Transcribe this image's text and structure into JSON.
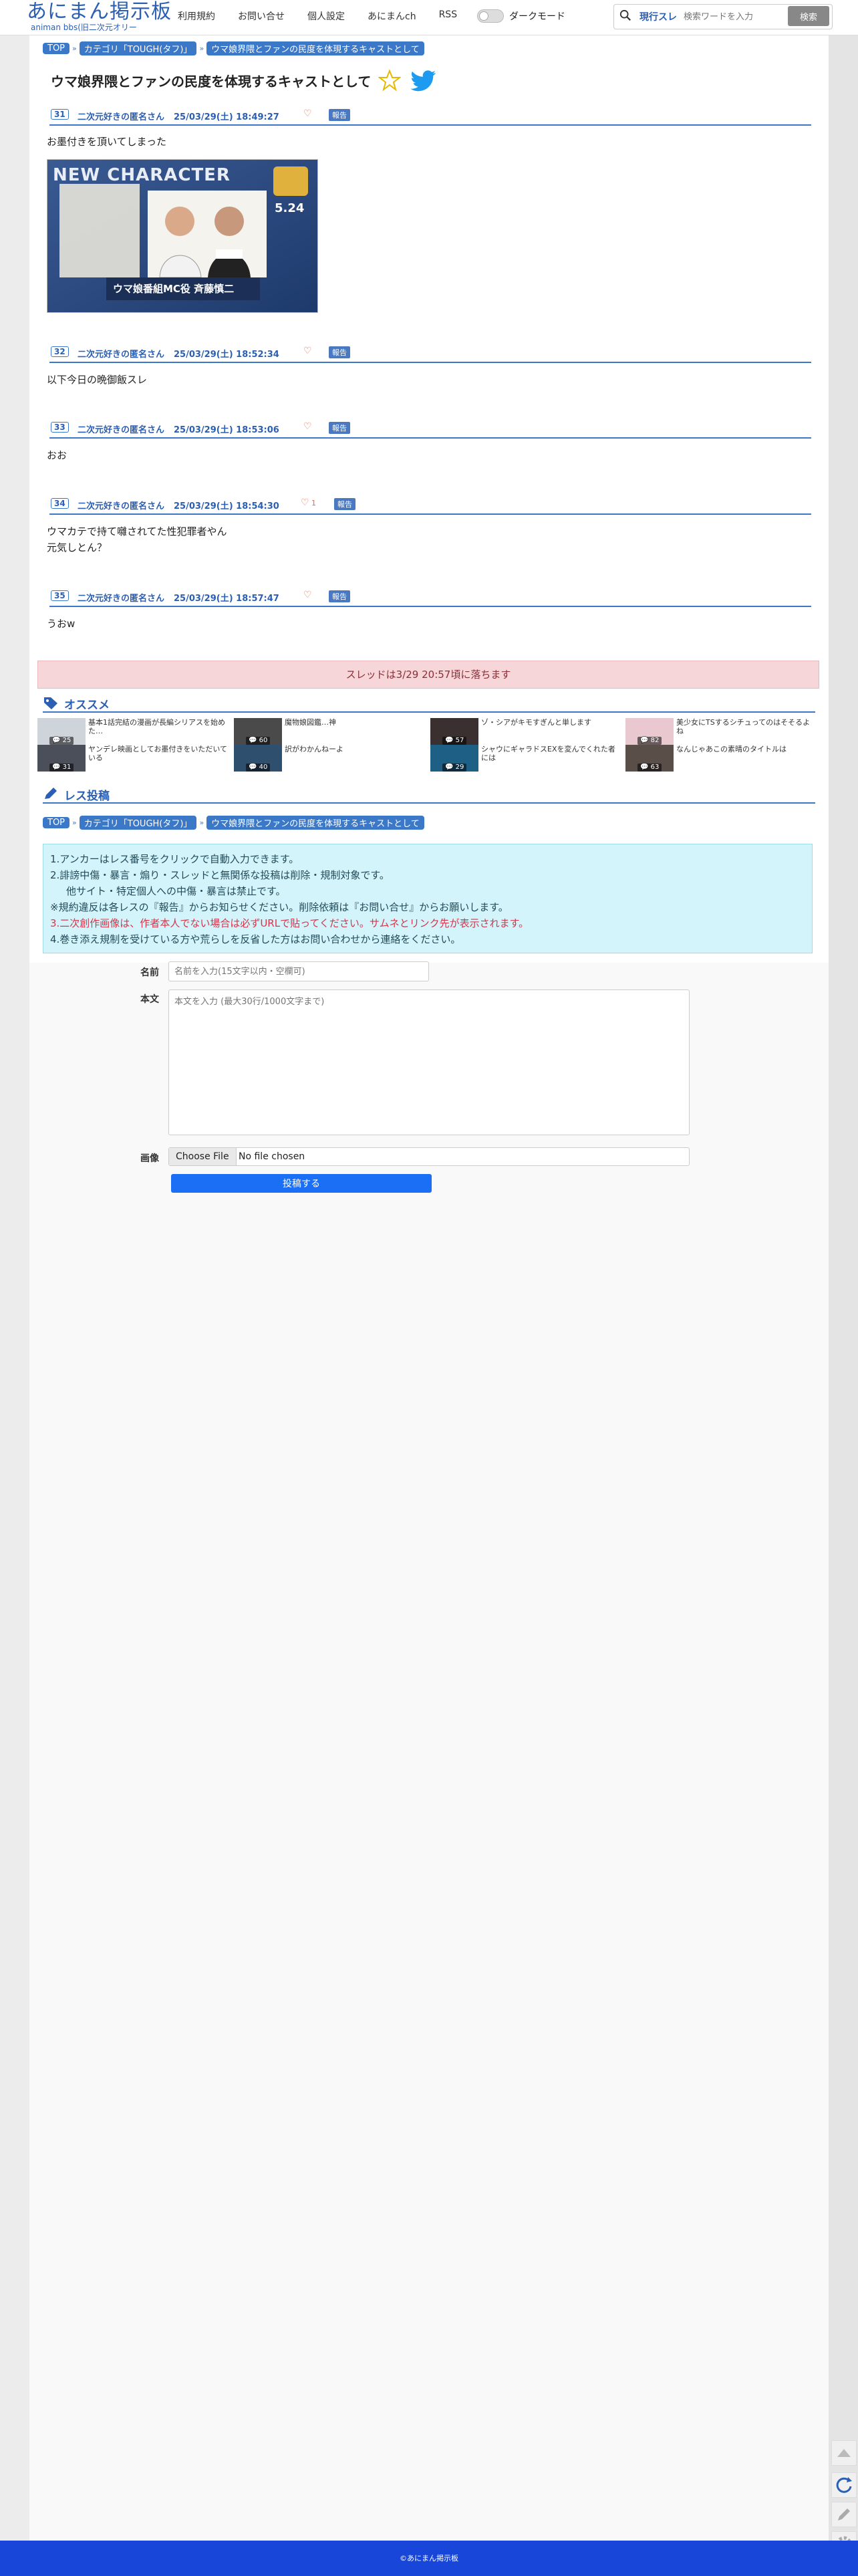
{
  "header": {
    "logo": "あにまん掲示板",
    "logo_sub": "animan bbs(旧二次元オリー",
    "nav": [
      "利用規約",
      "お問い合せ",
      "個人設定",
      "あにまんch",
      "RSS"
    ],
    "dark_mode": "ダークモード",
    "search_scope": "現行スレ",
    "search_placeholder": "検索ワードを入力",
    "search_button": "検索"
  },
  "breadcrumb": [
    "TOP",
    "カテゴリ「TOUGH(タフ)」",
    "ウマ娘界隈とファンの民度を体現するキャストとして"
  ],
  "thread_title": "ウマ娘界隈とファンの民度を体現するキャストとして",
  "posts": [
    {
      "num": "31",
      "name": "二次元好きの匿名さん",
      "date": "25/03/29(土) 18:49:27",
      "likes": "",
      "report": "報告",
      "lines": [
        "お墨付きを頂いてしまった"
      ]
    },
    {
      "num": "32",
      "name": "二次元好きの匿名さん",
      "date": "25/03/29(土) 18:52:34",
      "likes": "",
      "report": "報告",
      "lines": [
        "以下今日の晩御飯スレ"
      ]
    },
    {
      "num": "33",
      "name": "二次元好きの匿名さん",
      "date": "25/03/29(土) 18:53:06",
      "likes": "",
      "report": "報告",
      "lines": [
        "おお"
      ]
    },
    {
      "num": "34",
      "name": "二次元好きの匿名さん",
      "date": "25/03/29(土) 18:54:30",
      "likes": "1",
      "report": "報告",
      "lines": [
        "ウマカテで持て囃されてた性犯罪者やん",
        "元気しとん？"
      ]
    },
    {
      "num": "35",
      "name": "二次元好きの匿名さん",
      "date": "25/03/29(土) 18:57:47",
      "likes": "",
      "report": "報告",
      "lines": [
        "うおw"
      ]
    }
  ],
  "post_image": {
    "headline": "NEW CHARACTER",
    "caption": "ウマ娘番組MC役 斉藤慎二",
    "date_text": "5.24"
  },
  "thread_ended": "スレッドは3/29 20:57頃に落ちます",
  "recommend": {
    "heading": "オススメ",
    "items": [
      {
        "title": "基本1話完結の漫画が長編シリアスを始めた…",
        "count": "25"
      },
      {
        "title": "魔物娘図鑑…神",
        "count": "60"
      },
      {
        "title": "ゾ・シアがキモすぎんと単します",
        "count": "57"
      },
      {
        "title": "美少女にTSするシチュってのはそそるよね",
        "count": "82"
      },
      {
        "title": "ヤンデレ映画としてお墨付きをいただいている",
        "count": "31"
      },
      {
        "title": "訳がわかんねーよ",
        "count": "40"
      },
      {
        "title": "シャウにギャラドスEXを変んでくれた者には",
        "count": "29"
      },
      {
        "title": "なんじゃあこの素晴のタイトルは",
        "count": "63"
      }
    ]
  },
  "reply": {
    "heading": "レス投稿",
    "rules": [
      "1.アンカーはレス番号をクリックで自動入力できます。",
      "2.誹謗中傷・暴言・煽り・スレッドと無関係な投稿は削除・規制対象です。",
      "他サイト・特定個人への中傷・暴言は禁止です。",
      "※規約違反は各レスの『報告』からお知らせください。削除依頼は『お問い合せ』からお願いします。",
      "3.二次創作画像は、作者本人でない場合は必ずURLで貼ってください。サムネとリンク先が表示されます。",
      "4.巻き添え規制を受けている方や荒らしを反省した方はお問い合わせから連絡をください。"
    ],
    "name_label": "名前",
    "name_placeholder": "名前を入力(15文字以内・空欄可)",
    "body_label": "本文",
    "body_placeholder": "本文を入力 (最大30行/1000文字まで)",
    "image_label": "画像",
    "file_button": "Choose File",
    "file_status": "No file chosen",
    "submit": "投稿する"
  },
  "footer": "©あにまん掲示板",
  "colors": {
    "accent": "#3c78c8",
    "footer": "#1846d8",
    "submit": "#1a6ff5"
  }
}
